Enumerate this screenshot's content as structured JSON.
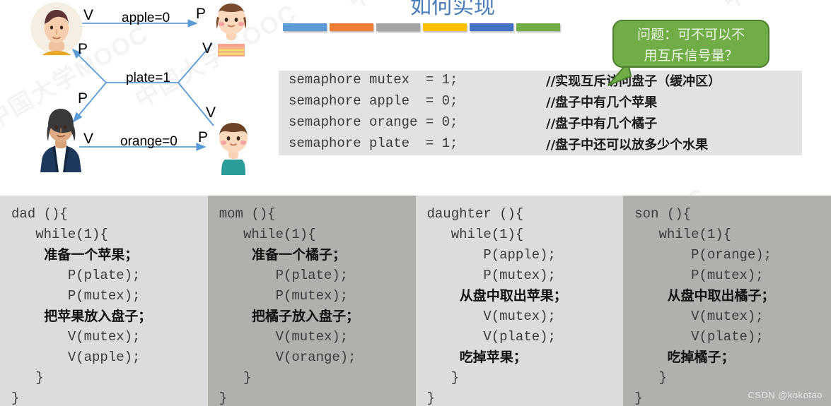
{
  "slide": {
    "title": "如何实现",
    "color_bars": [
      "#5b9bd5",
      "#ed7d31",
      "#a5a5a5",
      "#ffc000",
      "#4472c4",
      "#70ad47"
    ],
    "watermark_text": "中国大学MOOC",
    "credit": "CSDN @kokotao"
  },
  "diagram": {
    "actors": [
      {
        "role": "dad",
        "position": "top-left"
      },
      {
        "role": "daughter",
        "position": "top-right"
      },
      {
        "role": "mom",
        "position": "bottom-left"
      },
      {
        "role": "son",
        "position": "bottom-right"
      }
    ],
    "edges": [
      {
        "label": "apple=0",
        "from_op": "V",
        "to_op": "P"
      },
      {
        "label": "plate=1",
        "from_op": "P",
        "to_op": "V"
      },
      {
        "label": "orange=0",
        "from_op": "V",
        "to_op": "P"
      }
    ],
    "ops": {
      "dad_v": "V",
      "dad_p": "P",
      "daughter_p": "P",
      "daughter_v": "V",
      "mom_p": "P",
      "mom_v": "V",
      "son_v": "V",
      "son_p": "P"
    },
    "labels": {
      "apple": "apple=0",
      "plate": "plate=1",
      "orange": "orange=0"
    },
    "arrow_color": "#5b9bd5"
  },
  "callout": {
    "line1": "问题：可不可以不",
    "line2": "用互斥信号量？",
    "fill": "#70ad47",
    "border": "#4b7f2e"
  },
  "semaphores": [
    {
      "code": "semaphore mutex  = 1;",
      "comment": "//实现互斥访问盘子（缓冲区）"
    },
    {
      "code": "semaphore apple  = 0;",
      "comment": "//盘子中有几个苹果"
    },
    {
      "code": "semaphore orange = 0;",
      "comment": "//盘子中有几个橘子"
    },
    {
      "code": "semaphore plate  = 1;",
      "comment": "//盘子中还可以放多少个水果"
    }
  ],
  "panels": [
    {
      "name": "dad",
      "shade": "light",
      "lines": [
        {
          "text": "dad (){",
          "cn": false
        },
        {
          "text": "   while(1){",
          "cn": false
        },
        {
          "text": "       准备一个苹果；",
          "cn": true
        },
        {
          "text": "       P(plate);",
          "cn": false
        },
        {
          "text": "       P(mutex);",
          "cn": false
        },
        {
          "text": "       把苹果放入盘子；",
          "cn": true
        },
        {
          "text": "       V(mutex);",
          "cn": false
        },
        {
          "text": "       V(apple);",
          "cn": false
        },
        {
          "text": "   }",
          "cn": false
        },
        {
          "text": "}",
          "cn": false
        }
      ]
    },
    {
      "name": "mom",
      "shade": "dark",
      "lines": [
        {
          "text": "mom (){",
          "cn": false
        },
        {
          "text": "   while(1){",
          "cn": false
        },
        {
          "text": "       准备一个橘子；",
          "cn": true
        },
        {
          "text": "       P(plate);",
          "cn": false
        },
        {
          "text": "       P(mutex);",
          "cn": false
        },
        {
          "text": "       把橘子放入盘子；",
          "cn": true
        },
        {
          "text": "       V(mutex);",
          "cn": false
        },
        {
          "text": "       V(orange);",
          "cn": false
        },
        {
          "text": "   }",
          "cn": false
        },
        {
          "text": "}",
          "cn": false
        }
      ]
    },
    {
      "name": "daughter",
      "shade": "light",
      "lines": [
        {
          "text": "daughter (){",
          "cn": false
        },
        {
          "text": "   while(1){",
          "cn": false
        },
        {
          "text": "       P(apple);",
          "cn": false
        },
        {
          "text": "       P(mutex);",
          "cn": false
        },
        {
          "text": "       从盘中取出苹果；",
          "cn": true
        },
        {
          "text": "       V(mutex);",
          "cn": false
        },
        {
          "text": "       V(plate);",
          "cn": false
        },
        {
          "text": "       吃掉苹果；",
          "cn": true
        },
        {
          "text": "   }",
          "cn": false
        },
        {
          "text": "}",
          "cn": false
        }
      ]
    },
    {
      "name": "son",
      "shade": "dark",
      "lines": [
        {
          "text": "son (){",
          "cn": false
        },
        {
          "text": "   while(1){",
          "cn": false
        },
        {
          "text": "       P(orange);",
          "cn": false
        },
        {
          "text": "       P(mutex);",
          "cn": false
        },
        {
          "text": "       从盘中取出橘子；",
          "cn": true
        },
        {
          "text": "       V(mutex);",
          "cn": false
        },
        {
          "text": "       V(plate);",
          "cn": false
        },
        {
          "text": "       吃掉橘子；",
          "cn": true
        },
        {
          "text": "   }",
          "cn": false
        },
        {
          "text": "}",
          "cn": false
        }
      ]
    }
  ]
}
